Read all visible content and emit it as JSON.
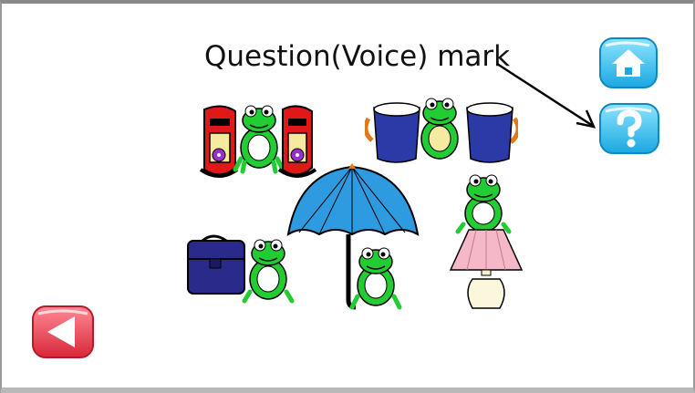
{
  "window": {
    "bg": "#ffffff"
  },
  "annotation": {
    "text": "Question(Voice) mark"
  },
  "buttons": {
    "home": {
      "icon": "home-icon",
      "color": "#3cc4f0"
    },
    "help": {
      "icon": "question-mark-icon",
      "color": "#3cc4f0"
    },
    "back": {
      "icon": "back-arrow-icon",
      "color": "#e83a4a"
    }
  },
  "scene": {
    "objects": [
      "shoes-with-frog",
      "cups-with-frog",
      "umbrella-with-frog",
      "lamp-with-frog",
      "bag-with-frog"
    ],
    "frog_color": "#22cc33"
  }
}
